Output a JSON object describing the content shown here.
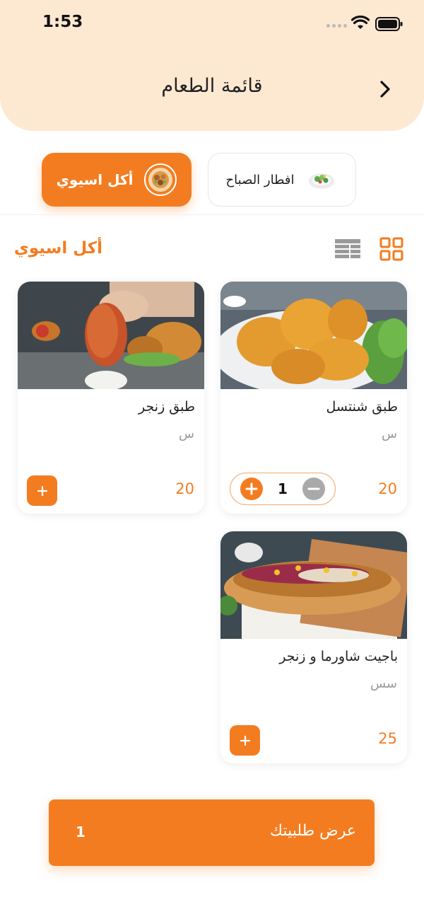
{
  "status_bar": {
    "time": "1:53"
  },
  "header": {
    "title": "قائمة الطعام",
    "back_icon": "chevron-right-icon"
  },
  "categories": [
    {
      "label": "افطار الصباح",
      "selected": false
    },
    {
      "label": "أكل اسيوي",
      "selected": true
    }
  ],
  "section": {
    "title": "أكل اسيوي",
    "view_mode": "grid"
  },
  "products": [
    {
      "name": "طبق شنتسل",
      "description": "س",
      "price": "20",
      "quantity": "1"
    },
    {
      "name": "طبق زنجر",
      "description": "س",
      "price": "20",
      "quantity": "0"
    },
    {
      "name": "باجيت شاورما و زنجر",
      "description": "سس",
      "price": "25",
      "quantity": "0"
    }
  ],
  "cart": {
    "label": "عرض طلبيتك",
    "count": "1"
  },
  "colors": {
    "accent": "#f47c20",
    "header_bg": "#fde8d2",
    "stepper_minus": "#a9a9a9"
  }
}
